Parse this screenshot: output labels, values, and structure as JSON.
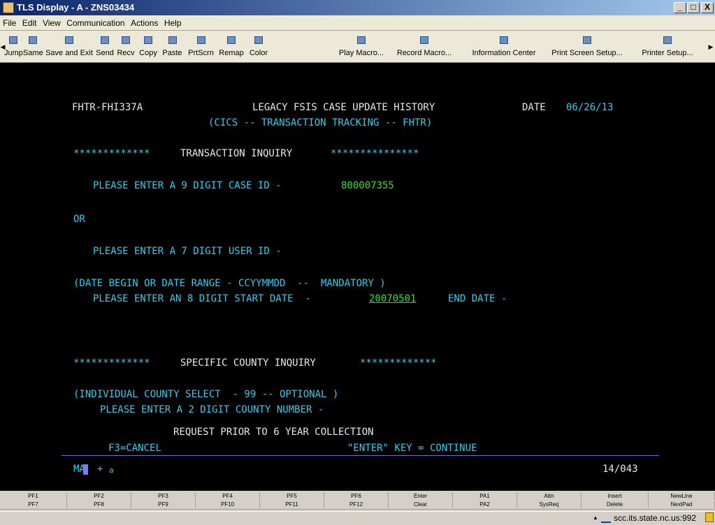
{
  "window": {
    "title": "TLS Display - A - ZNS03434",
    "min": "_",
    "max": "□",
    "close": "X"
  },
  "menu": [
    "File",
    "Edit",
    "View",
    "Communication",
    "Actions",
    "Help"
  ],
  "toolbar": [
    {
      "label": "Jump",
      "icon": "jump-icon"
    },
    {
      "label": "Same",
      "icon": "same-icon"
    },
    {
      "label": "Save and Exit",
      "icon": "save-exit-icon"
    },
    {
      "label": "Send",
      "icon": "send-icon"
    },
    {
      "label": "Recv",
      "icon": "receive-icon"
    },
    {
      "label": "Copy",
      "icon": "copy-icon"
    },
    {
      "label": "Paste",
      "icon": "paste-icon"
    },
    {
      "label": "PrtScrn",
      "icon": "print-screen-icon"
    },
    {
      "label": "Remap",
      "icon": "remap-icon"
    },
    {
      "label": "Color",
      "icon": "color-icon"
    },
    {
      "label": "Play Macro...",
      "icon": "play-macro-icon"
    },
    {
      "label": "Record Macro...",
      "icon": "record-macro-icon"
    },
    {
      "label": "Information Center",
      "icon": "info-center-icon"
    },
    {
      "label": "Print Screen Setup...",
      "icon": "print-setup-icon"
    },
    {
      "label": "Printer Setup...",
      "icon": "printer-setup-icon"
    }
  ],
  "terminal": {
    "screen_id": "FHTR-FHI337A",
    "title": "LEGACY FSIS CASE UPDATE HISTORY",
    "date_label": "DATE",
    "date_value": "06/26/13",
    "subtitle": "(CICS -- TRANSACTION TRACKING -- FHTR)",
    "tx_stars_left": "*************",
    "tx_heading": "TRANSACTION INQUIRY",
    "tx_stars_right": "***************",
    "case_prompt": "PLEASE ENTER A 9 DIGIT CASE ID -",
    "case_value": "800007355",
    "or_label": "OR",
    "user_prompt": "PLEASE ENTER A 7 DIGIT USER ID -",
    "date_range_note": "(DATE BEGIN OR DATE RANGE - CCYYMMDD  --  MANDATORY )",
    "start_prompt": "PLEASE ENTER AN 8 DIGIT START DATE  -",
    "start_value": "20070501",
    "end_label": "END DATE -",
    "county_stars_left": "*************",
    "county_heading": "SPECIFIC COUNTY INQUIRY",
    "county_stars_right": "*************",
    "county_note": "(INDIVIDUAL COUNTY SELECT  - 99 -- OPTIONAL )",
    "county_prompt": "PLEASE ENTER A 2 DIGIT COUNTY NUMBER -",
    "request_note": "REQUEST PRIOR TO 6 YEAR COLLECTION",
    "f3_label": "F3=CANCEL",
    "enter_label": "\"ENTER\" KEY = CONTINUE",
    "oia_ma": "MA",
    "oia_plus": "+",
    "oia_a": "a",
    "cursor_pos": "14/043"
  },
  "pf_row1": [
    "PF1",
    "PF2",
    "PF3",
    "PF4",
    "PF5",
    "PF6",
    "Enter",
    "PA1",
    "Attn",
    "Insert",
    "NewLine"
  ],
  "pf_row2": [
    "PF7",
    "PF8",
    "PF9",
    "PF10",
    "PF11",
    "PF12",
    "Clear",
    "PA2",
    "SysReq",
    "Delete",
    "NextPad"
  ],
  "status": {
    "host": "scc.its.state.nc.us:992",
    "up_arrow": "▲"
  },
  "colors": {
    "terminal_bg": "#000000",
    "cyan": "#33ccee",
    "green": "#33dd33",
    "white": "#e8e8e8"
  }
}
